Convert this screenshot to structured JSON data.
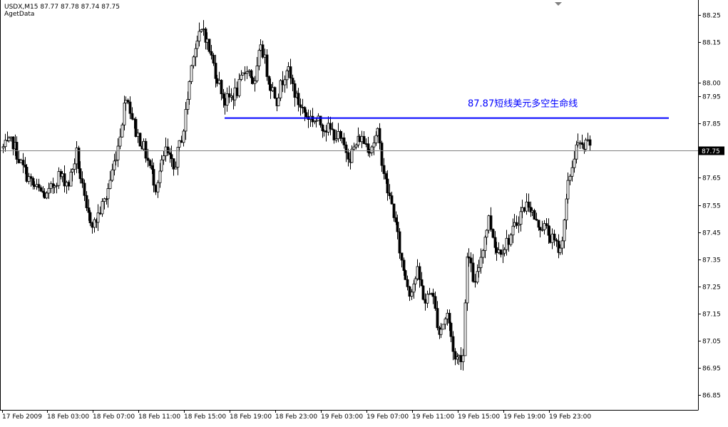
{
  "header": {
    "symbol": "USDX,M15",
    "ohlc": "87.77 87.78 87.74 87.75",
    "source": "AgetData"
  },
  "colors": {
    "background": "#ffffff",
    "frame": "#000000",
    "candle": "#000000",
    "bull_body": "#ffffff",
    "bear_body": "#000000",
    "level_line": "#0000ff",
    "annotation": "#0000ff",
    "price_line": "#808080",
    "price_tag_bg": "#000000",
    "price_tag_text": "#ffffff"
  },
  "chart_data": {
    "type": "candlestick",
    "timeframe": "M15",
    "ylim": [
      86.8,
      88.27
    ],
    "y_ticks": [
      "88.25",
      "88.15",
      "88.00",
      "87.95",
      "87.85",
      "87.75",
      "87.65",
      "87.55",
      "87.45",
      "87.35",
      "87.25",
      "87.15",
      "87.05",
      "86.95",
      "86.85"
    ],
    "x_ticks": [
      "17 Feb 2009",
      "18 Feb 03:00",
      "18 Feb 07:00",
      "18 Feb 11:00",
      "18 Feb 15:00",
      "18 Feb 19:00",
      "18 Feb 23:00",
      "19 Feb 03:00",
      "19 Feb 07:00",
      "19 Feb 11:00",
      "19 Feb 15:00",
      "19 Feb 19:00",
      "19 Feb 23:00"
    ],
    "current_price": 87.75,
    "current_price_label": "87.75",
    "level": {
      "value": 87.87,
      "label": "87.87短线美元多空生命线"
    },
    "price_path": [
      [
        0,
        87.76
      ],
      [
        5,
        87.78
      ],
      [
        9,
        87.7
      ],
      [
        15,
        87.62
      ],
      [
        22,
        87.58
      ],
      [
        28,
        87.66
      ],
      [
        33,
        87.63
      ],
      [
        37,
        87.74
      ],
      [
        42,
        87.52
      ],
      [
        46,
        87.48
      ],
      [
        52,
        87.58
      ],
      [
        58,
        87.77
      ],
      [
        62,
        87.96
      ],
      [
        67,
        87.82
      ],
      [
        71,
        87.76
      ],
      [
        77,
        87.62
      ],
      [
        82,
        87.75
      ],
      [
        86,
        87.68
      ],
      [
        91,
        87.83
      ],
      [
        96,
        88.12
      ],
      [
        101,
        88.2
      ],
      [
        107,
        88.04
      ],
      [
        112,
        87.93
      ],
      [
        118,
        87.97
      ],
      [
        123,
        88.06
      ],
      [
        127,
        87.99
      ],
      [
        130,
        88.15
      ],
      [
        134,
        88.01
      ],
      [
        138,
        87.94
      ],
      [
        143,
        88.06
      ],
      [
        148,
        87.94
      ],
      [
        153,
        87.88
      ],
      [
        158,
        87.86
      ],
      [
        164,
        87.83
      ],
      [
        169,
        87.8
      ],
      [
        175,
        87.73
      ],
      [
        180,
        87.8
      ],
      [
        185,
        87.76
      ],
      [
        189,
        87.81
      ],
      [
        193,
        87.63
      ],
      [
        197,
        87.52
      ],
      [
        201,
        87.34
      ],
      [
        205,
        87.23
      ],
      [
        209,
        87.3
      ],
      [
        213,
        87.19
      ],
      [
        216,
        87.24
      ],
      [
        220,
        87.08
      ],
      [
        224,
        87.15
      ],
      [
        228,
        86.98
      ],
      [
        232,
        87.0
      ],
      [
        234,
        87.38
      ],
      [
        238,
        87.25
      ],
      [
        242,
        87.4
      ],
      [
        245,
        87.5
      ],
      [
        249,
        87.38
      ],
      [
        253,
        87.4
      ],
      [
        257,
        87.45
      ],
      [
        261,
        87.52
      ],
      [
        265,
        87.56
      ],
      [
        269,
        87.48
      ],
      [
        273,
        87.47
      ],
      [
        277,
        87.42
      ],
      [
        281,
        87.38
      ],
      [
        285,
        87.62
      ],
      [
        289,
        87.77
      ],
      [
        293,
        87.76
      ],
      [
        296,
        87.78
      ]
    ]
  }
}
